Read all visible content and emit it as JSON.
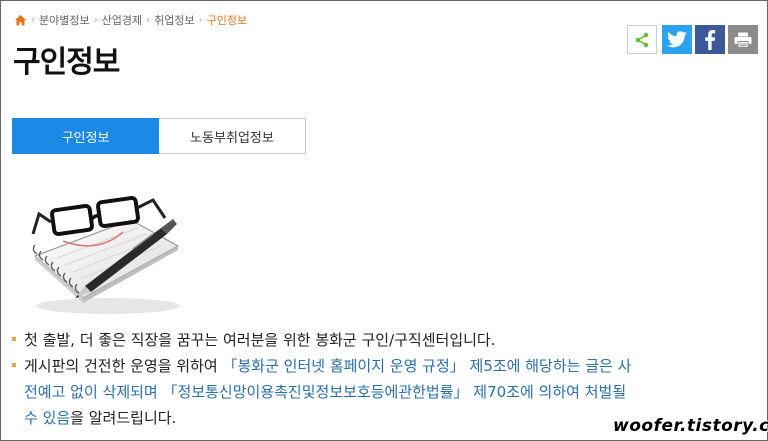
{
  "breadcrumb": {
    "items": [
      "분야별정보",
      "산업경제",
      "취업정보"
    ],
    "current": "구인정보"
  },
  "page_title": "구인정보",
  "share_bar": {
    "icons": [
      "share-icon",
      "twitter-icon",
      "facebook-icon",
      "print-icon"
    ],
    "colors": {
      "twitter": "#2aa3ef",
      "facebook": "#3b5998",
      "print": "#8c8c8c",
      "share": "#6dbb3a"
    }
  },
  "tabs": [
    {
      "label": "구인정보",
      "active": true
    },
    {
      "label": "노동부취업정보",
      "active": false
    }
  ],
  "info": {
    "line1": "첫 출발, 더 좋은 직장을 꿈꾸는 여러분을 위한 봉화군 구인/구직센터입니다.",
    "line2_a": "게시판의 건전한 운영을 위하여 ",
    "line2_link": "「봉화군 인터넷 홈페이지 운영 규정」",
    "line2_b": " 제5조에 해당하는 글은 사",
    "line2_c": "전예고 없이 삭제되며 ",
    "line2_link2": "「정보통신망이용촉진및정보보호등에관한법률」",
    "line2_d": " 제70조에 의하여 처벌될",
    "line2_e": "수 있음을 알려드립니다."
  },
  "watermark": "woofer.tistory.com",
  "colors": {
    "accent": "#1a8ae6",
    "breadcrumb_current": "#e8731a",
    "link": "#2a6fb0"
  }
}
